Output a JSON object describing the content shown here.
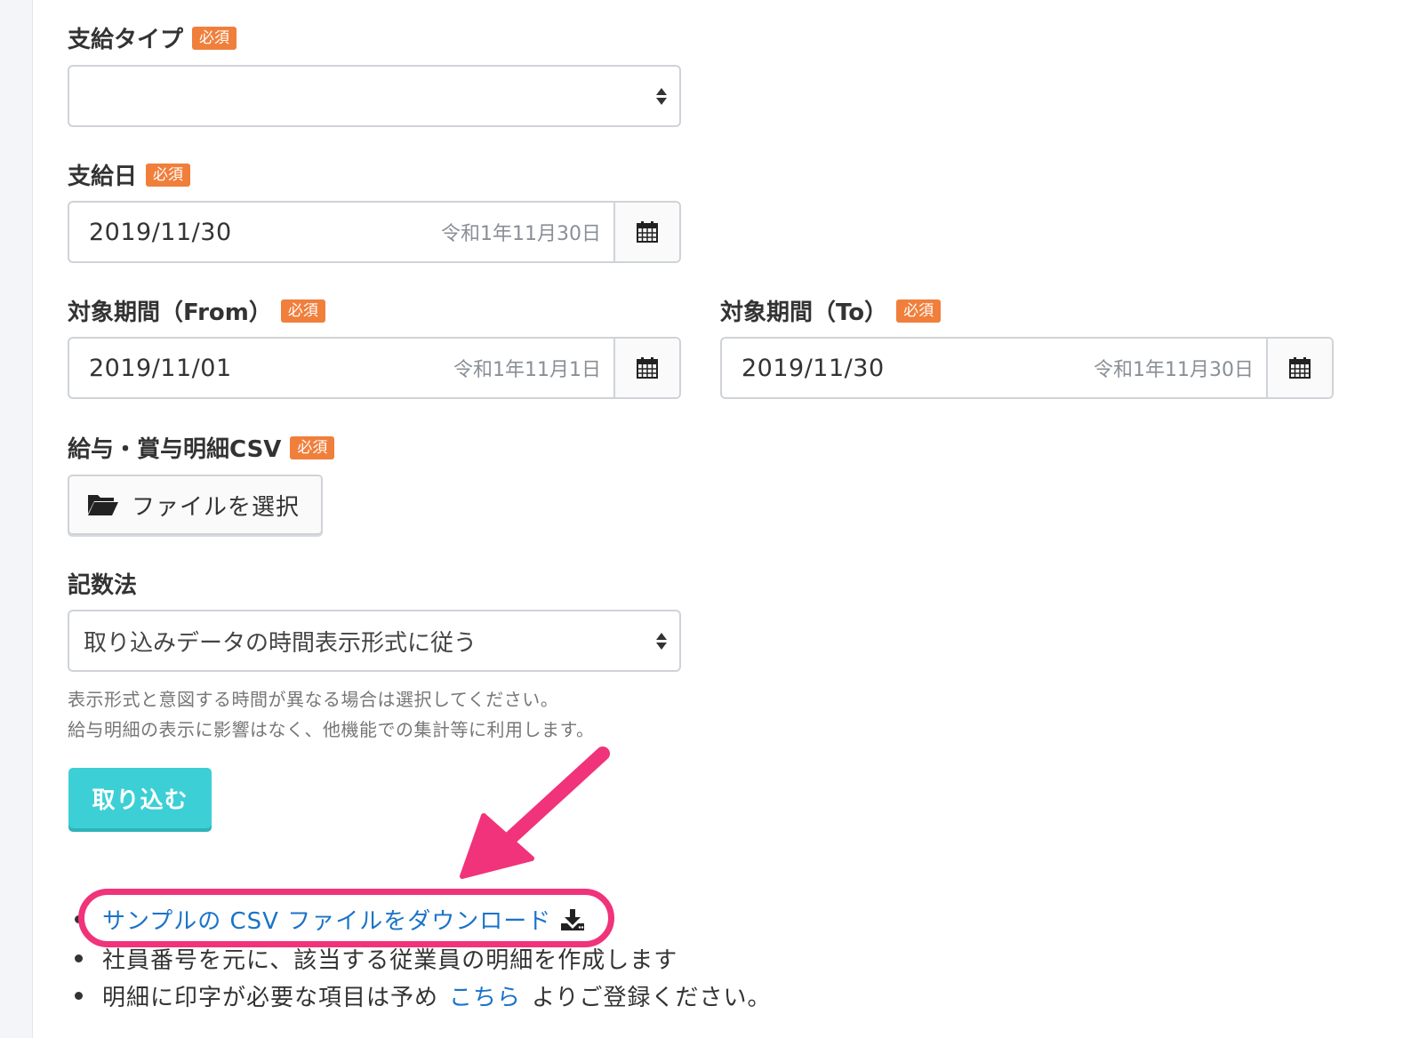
{
  "form": {
    "payment_type": {
      "label": "支給タイプ",
      "required_badge": "必須",
      "selected_value": ""
    },
    "payment_date": {
      "label": "支給日",
      "required_badge": "必須",
      "value": "2019/11/30",
      "era": "令和1年11月30日"
    },
    "period_from": {
      "label": "対象期間（From）",
      "required_badge": "必須",
      "value": "2019/11/01",
      "era": "令和1年11月1日"
    },
    "period_to": {
      "label": "対象期間（To）",
      "required_badge": "必須",
      "value": "2019/11/30",
      "era": "令和1年11月30日"
    },
    "csv_file": {
      "label": "給与・賞与明細CSV",
      "required_badge": "必須",
      "button_label": "ファイルを選択"
    },
    "notation": {
      "label": "記数法",
      "selected_value": "取り込みデータの時間表示形式に従う",
      "help_line1": "表示形式と意図する時間が異なる場合は選択してください。",
      "help_line2": "給与明細の表示に影響はなく、他機能での集計等に利用します。"
    },
    "import_button": "取り込む"
  },
  "notes": {
    "download_link": "サンプルの CSV ファイルをダウンロード",
    "item2": "社員番号を元に、該当する従業員の明細を作成します",
    "item3_before": "明細に印字が必要な項目は予め",
    "item3_link": "こちら",
    "item3_after": "よりご登録ください。"
  },
  "colors": {
    "required_badge": "#f07f3c",
    "primary_button": "#3ccfd6",
    "link": "#1a73c8",
    "annotation": "#f0337a"
  },
  "icons": {
    "calendar": "calendar-icon",
    "folder": "folder-open-icon",
    "download": "download-icon",
    "select_arrows": "sort-arrows-icon"
  }
}
